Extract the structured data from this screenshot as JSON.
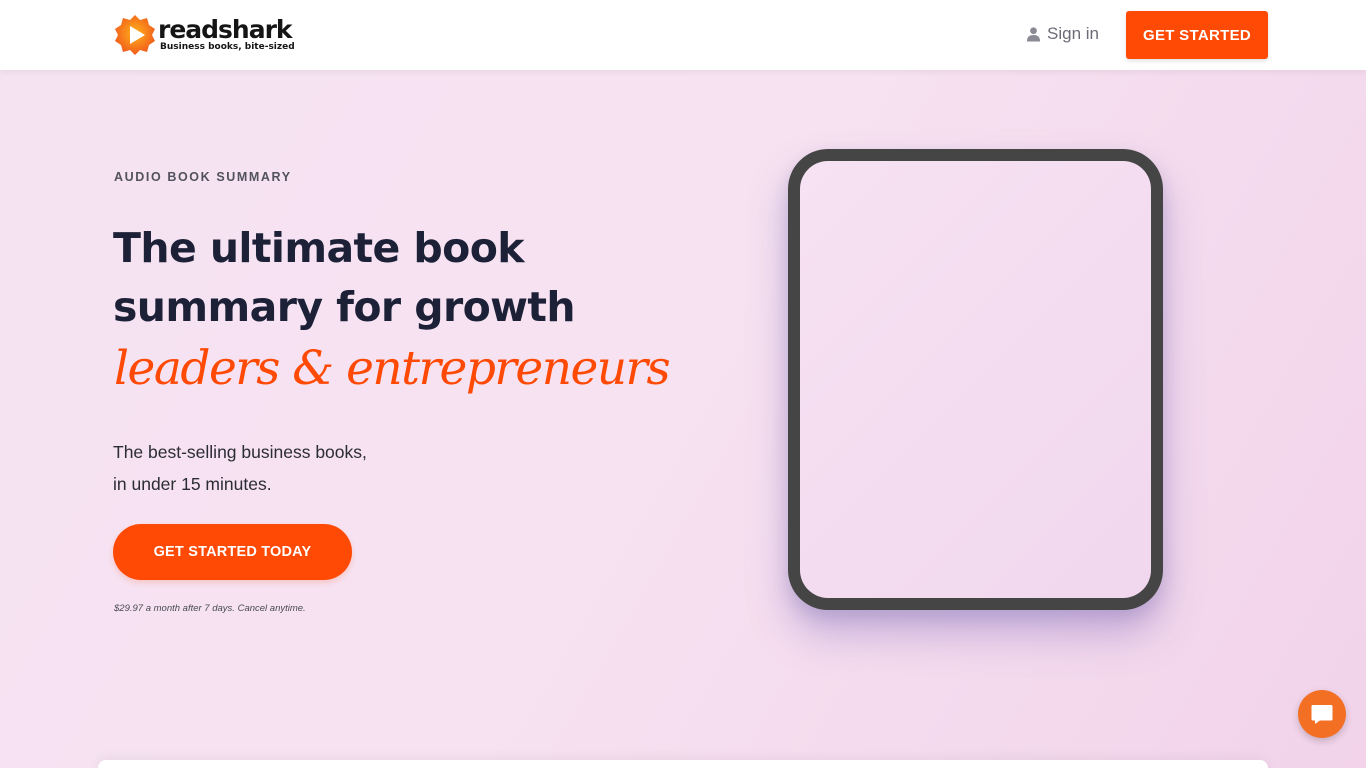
{
  "header": {
    "logo_name": "readshark",
    "logo_tagline": "Business books, bite-sized",
    "sign_in_label": "Sign in",
    "get_started_label": "GET STARTED"
  },
  "hero": {
    "eyebrow": "AUDIO BOOK SUMMARY",
    "headline_line1": "The ultimate book",
    "headline_line2": "summary for growth",
    "script_line": "leaders & entrepreneurs",
    "subline1": "The best-selling business books,",
    "subline2": "in under 15 minutes.",
    "cta_label": "GET STARTED TODAY",
    "fineprint": "$29.97 a month after 7 days. Cancel anytime."
  },
  "icons": {
    "user": "user-icon",
    "chat": "chat-icon",
    "logo": "readshark-logo-icon"
  },
  "colors": {
    "accent": "#fe4a05",
    "chat": "#f36f24",
    "heading": "#1d2138",
    "background": "#f5e3f2",
    "tablet_frame": "#454545"
  }
}
